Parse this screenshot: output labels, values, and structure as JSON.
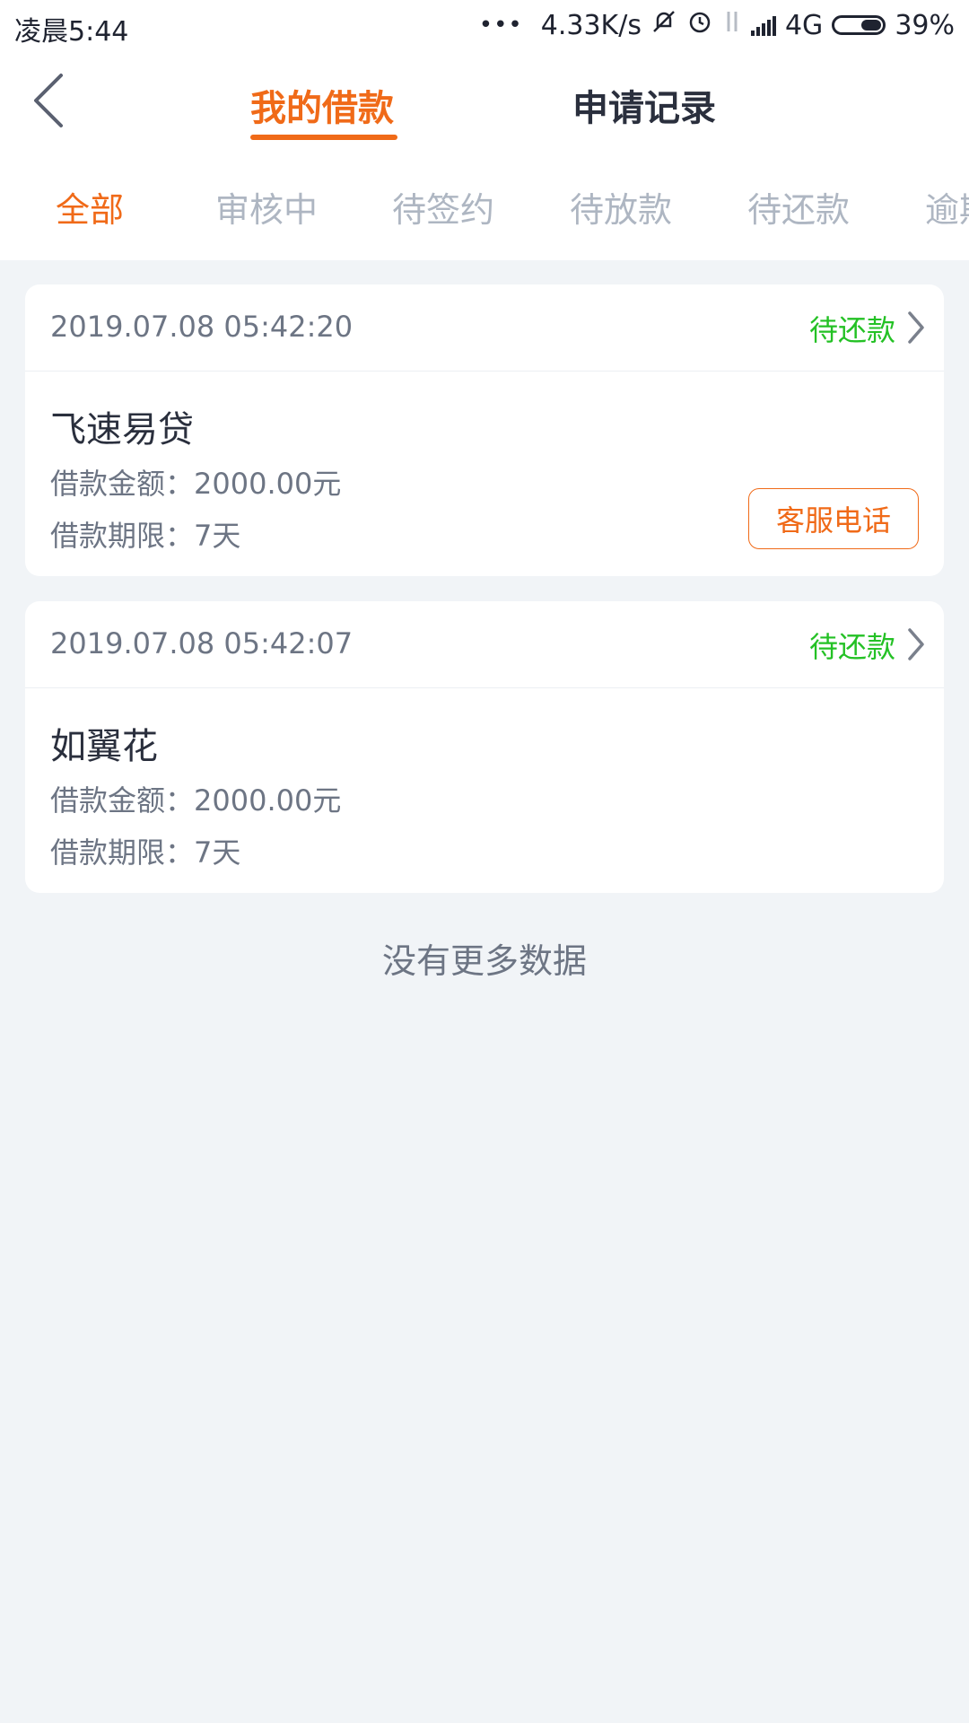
{
  "status_bar": {
    "time": "凌晨5:44",
    "dots": "•••",
    "speed": "4.33K/s",
    "network": "4G",
    "battery": "39%"
  },
  "header": {
    "tabs": [
      {
        "label": "我的借款",
        "active": true
      },
      {
        "label": "申请记录",
        "active": false
      }
    ],
    "filters": [
      "全部",
      "审核中",
      "待签约",
      "待放款",
      "待还款",
      "逾期"
    ]
  },
  "loans": [
    {
      "date": "2019.07.08 05:42:20",
      "status": "待还款",
      "name": "飞速易贷",
      "amount": "借款金额：2000.00元",
      "term": "借款期限：7天",
      "button": "客服电话"
    },
    {
      "date": "2019.07.08 05:42:07",
      "status": "待还款",
      "name": "如翼花",
      "amount": "借款金额：2000.00元",
      "term": "借款期限：7天"
    }
  ],
  "footer": {
    "no_more": "没有更多数据"
  },
  "colors": {
    "accent": "#f06a18",
    "status_green": "#24c125",
    "background": "#f1f4f7"
  }
}
